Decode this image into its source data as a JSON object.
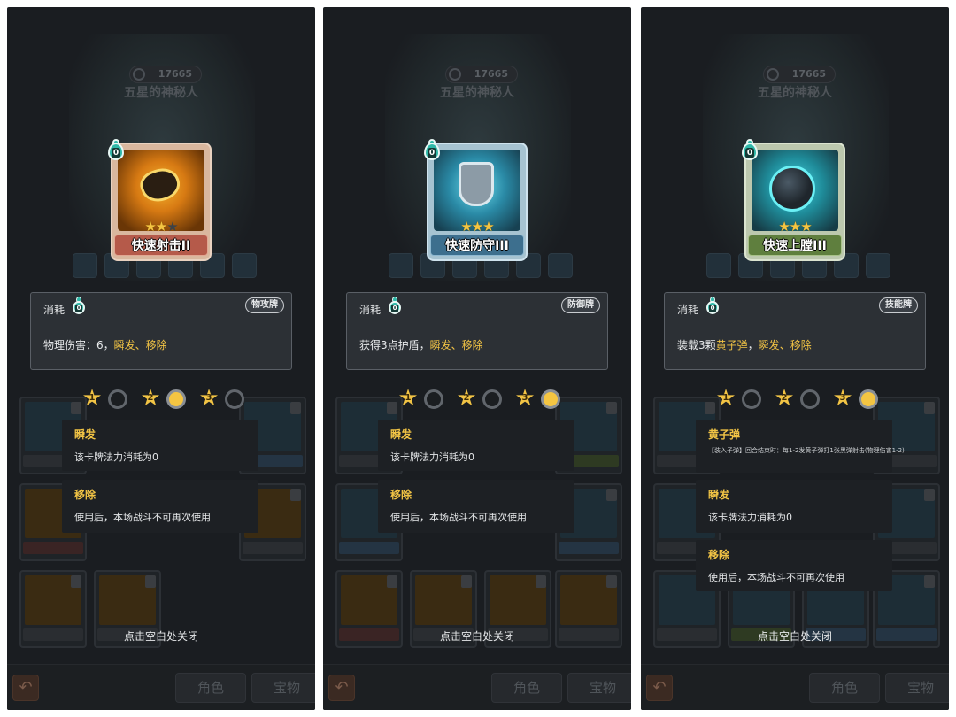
{
  "ui": {
    "score": "17665",
    "enemy_name": "五星的神秘人",
    "cost_label": "消耗",
    "close_hint": "点击空白处关闭",
    "tab_role": "角色",
    "tab_treasure": "宝物",
    "back_icon": "back-arrow-icon",
    "level_labels": [
      "1",
      "2",
      "3"
    ]
  },
  "panels": [
    {
      "card": {
        "name": "快速射击II",
        "cost": "0",
        "stars": 2,
        "max_stars": 3,
        "theme": "orange",
        "art_icon": "gem-shot-icon"
      },
      "type_badge": "物攻牌",
      "description": {
        "prefix": "物理伤害：6，",
        "kw1": "瞬发",
        "sep": "、",
        "kw2": "移除"
      },
      "active_level": 2,
      "tooltips": [
        {
          "title": "瞬发",
          "text": "该卡牌法力消耗为0"
        },
        {
          "title": "移除",
          "text": "使用后，本场战斗不可再次使用"
        }
      ]
    },
    {
      "card": {
        "name": "快速防守III",
        "cost": "0",
        "stars": 3,
        "max_stars": 3,
        "theme": "blue",
        "art_icon": "shield-icon"
      },
      "type_badge": "防御牌",
      "description": {
        "prefix": "获得3点护盾，",
        "kw1": "瞬发",
        "sep": "、",
        "kw2": "移除"
      },
      "active_level": 3,
      "tooltips": [
        {
          "title": "瞬发",
          "text": "该卡牌法力消耗为0"
        },
        {
          "title": "移除",
          "text": "使用后，本场战斗不可再次使用"
        }
      ]
    },
    {
      "card": {
        "name": "快速上膛III",
        "cost": "0",
        "stars": 3,
        "max_stars": 3,
        "theme": "green",
        "art_icon": "bullet-orb-icon"
      },
      "type_badge": "技能牌",
      "description": {
        "pre0": "装载3颗",
        "kw0": "黄子弹",
        "prefix": "，",
        "kw1": "瞬发",
        "sep": "、",
        "kw2": "移除"
      },
      "active_level": 3,
      "tooltips": [
        {
          "title": "黄子弹",
          "text": "【装入子弹】回合结束时：每1-2发黄子弹打1张黑弹射击(物理伤害1-2)"
        },
        {
          "title": "瞬发",
          "text": "该卡牌法力消耗为0"
        },
        {
          "title": "移除",
          "text": "使用后，本场战斗不可再次使用"
        }
      ]
    }
  ]
}
